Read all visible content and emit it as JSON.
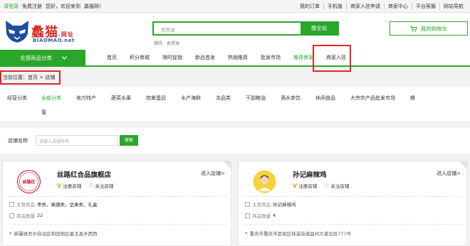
{
  "topbar": {
    "login": "请登录",
    "register": "免费注册",
    "welcome": "您好，欢迎来到",
    "site_name": "蠡猫网！",
    "right_links": [
      "我的订单",
      "手机版",
      "商家入驻申请",
      "商家中心",
      "平台客服",
      "网站导航"
    ]
  },
  "header": {
    "logo_cn": "蠡猫",
    "logo_cn_small": ".网址",
    "logo_en": "BIAOMAO.net",
    "search_placeholder": "食用油",
    "search_button": "搜全站",
    "hot_words": [
      "腊肉",
      "食用油"
    ],
    "cart_label": "我的购物车"
  },
  "nav": {
    "all_categories": "全部商品分类",
    "items": [
      "首页",
      "积分商城",
      "限时促销",
      "新品首发",
      "热销推荐",
      "批发市场",
      "推荐商家",
      "商家入驻"
    ],
    "active_index": 6
  },
  "breadcrumb": "当前位置：首页 > 店铺",
  "categories": {
    "label": "经营分类",
    "items": [
      "全部分类",
      "地方特产",
      "蔬菜水果",
      "肉禽蛋品",
      "水产海鲜",
      "冻品类",
      "干副粮油",
      "酒水茶饮",
      "休闲食品",
      "大宗农产品批发市场",
      "蜂"
    ],
    "second_row": "蜜",
    "active_index": 0
  },
  "filter": {
    "label": "店铺名称",
    "placeholder": "请输入店铺名称",
    "button": "搜索"
  },
  "shops": [
    {
      "name": "丝路红合品旗舰店",
      "enter": "进入店铺>",
      "tag1": "注册店铺",
      "tag2": "关注店铺",
      "main_label": "主营商品",
      "main_value": "枣类，果脯类，坚果类，礼盒",
      "count_label": "商品数量",
      "count_value": "22",
      "address": "新疆维吾尔自治区和田地区墨玉县乡西西",
      "avatar_text": "丝路红"
    },
    {
      "name": "孙记麻辣鸡",
      "enter": "进入店铺>",
      "tag1": "注册店铺",
      "tag2": "关注店铺",
      "main_label": "主营商品",
      "main_value": "孙记麻辣鸡",
      "count_label": "商品数量",
      "count_value": "4",
      "address": "重庆市重庆市武侯区桂溪街道益州大道北段777号"
    }
  ],
  "colors": {
    "brand_green": "#2aa72a",
    "highlight_red": "#e0262a"
  }
}
